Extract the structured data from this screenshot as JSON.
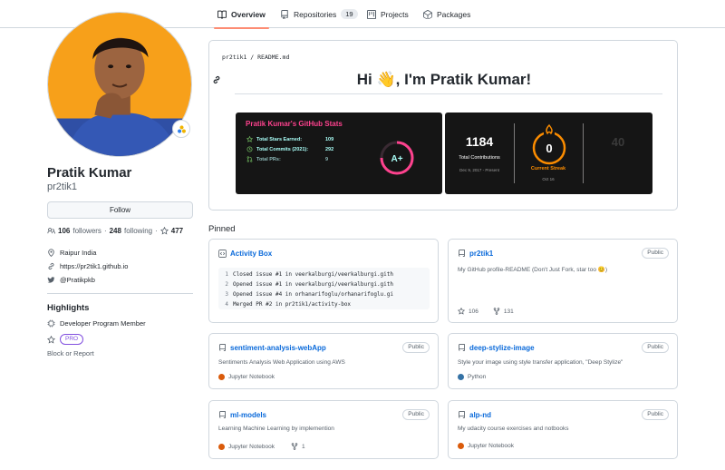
{
  "nav": {
    "tabs": [
      {
        "label": "Overview",
        "icon": "book-icon",
        "active": true
      },
      {
        "label": "Repositories",
        "icon": "repo-icon",
        "count": "19"
      },
      {
        "label": "Projects",
        "icon": "project-icon"
      },
      {
        "label": "Packages",
        "icon": "package-icon"
      }
    ]
  },
  "profile": {
    "name": "Pratik Kumar",
    "username": "pr2tik1",
    "follow_label": "Follow",
    "followers_count": "106",
    "followers_label": "followers",
    "following_count": "248",
    "following_label": "following",
    "stars_count": "477",
    "location": "Raipur India",
    "website": "https://pr2tik1.github.io",
    "twitter": "@Pratikpkb",
    "highlights_title": "Highlights",
    "highlight_program": "Developer Program Member",
    "highlight_pro": "PRO",
    "block_label": "Block or Report"
  },
  "readme": {
    "path": "pr2tik1 / README.md",
    "title": "Hi 👋, I'm Pratik Kumar!",
    "stats_card": {
      "title": "Pratik Kumar's GitHub Stats",
      "lines": [
        {
          "label": "Total Stars Earned:",
          "value": "109"
        },
        {
          "label": "Total Commits (2021):",
          "value": "292"
        },
        {
          "label": "Total PRs:",
          "value": "9"
        }
      ],
      "grade": "A+",
      "color_title": "#fe428e",
      "color_text": "#a9fef7"
    },
    "streak_card": {
      "total": "1184",
      "total_label": "Total Contributions",
      "total_range": "Dec 9, 2017 - Present",
      "current": "0",
      "current_label": "Current Streak",
      "current_date": "Oct 16",
      "longest": "40",
      "accent": "#fb8c00"
    }
  },
  "pinned": {
    "heading": "Pinned",
    "items": [
      {
        "name": "Activity Box",
        "type": "gist",
        "code": [
          {
            "n": "1",
            "text": "Closed issue #1 in veerkalburgi/veerkalburgi.gith"
          },
          {
            "n": "2",
            "text": "Opened issue #1 in veerkalburgi/veerkalburgi.gith"
          },
          {
            "n": "3",
            "text": "Opened issue #4 in orhanarifoglu/orhanarifoglu.gi"
          },
          {
            "n": "4",
            "text": "Merged PR #2 in pr2tik1/activity-box"
          }
        ]
      },
      {
        "name": "pr2tik1",
        "visibility": "Public",
        "description": "My GitHub profile-README (Don't Just Fork, star too 😊)",
        "stars": "106",
        "forks": "131"
      },
      {
        "name": "sentiment-analysis-webApp",
        "visibility": "Public",
        "description": "Sentiments Analysis Web Application using AWS",
        "language": "Jupyter Notebook",
        "language_color": "#DA5B0B"
      },
      {
        "name": "deep-stylize-image",
        "visibility": "Public",
        "description": "Style your image using style transfer application, \"Deep Stylize\"",
        "language": "Python",
        "language_color": "#3572A5"
      },
      {
        "name": "ml-models",
        "visibility": "Public",
        "description": "Learning Machine Learning by implemention",
        "language": "Jupyter Notebook",
        "language_color": "#DA5B0B",
        "forks": "1"
      },
      {
        "name": "alp-nd",
        "visibility": "Public",
        "description": "My udacity course exercises and notbooks",
        "language": "Jupyter Notebook",
        "language_color": "#DA5B0B"
      }
    ]
  }
}
